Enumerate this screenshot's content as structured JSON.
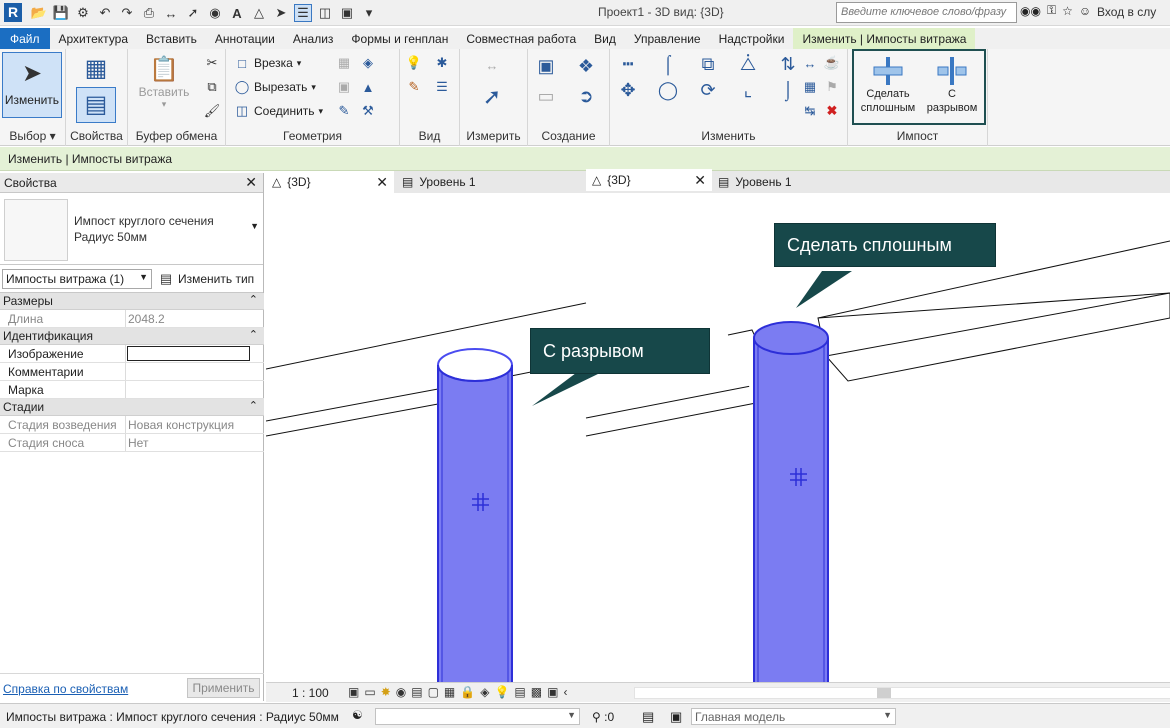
{
  "app": {
    "logo": "R",
    "title": "Проект1 - 3D вид: {3D}",
    "search_placeholder": "Введите ключевое слово/фразу",
    "login": "Вход в слу"
  },
  "tabs": [
    "Файл",
    "Архитектура",
    "Вставить",
    "Аннотации",
    "Анализ",
    "Формы и генплан",
    "Совместная работа",
    "Вид",
    "Управление",
    "Надстройки",
    "Изменить | Импосты витража"
  ],
  "ribbon": {
    "modify_label": "Изменить",
    "paste_label": "Вставить",
    "groups": {
      "select": "Выбор",
      "properties": "Свойства",
      "clipboard": "Буфер обмена",
      "geometry": "Геометрия",
      "view": "Вид",
      "measure": "Измерить",
      "create": "Создание",
      "modify": "Изменить",
      "mullion": "Импост"
    },
    "geometry_buttons": [
      "Врезка",
      "Вырезать",
      "Соединить"
    ],
    "mullion_buttons": {
      "solid": "Сделать сплошным",
      "break": "С разрывом"
    }
  },
  "context_bar": "Изменить | Импосты витража",
  "properties": {
    "title": "Свойства",
    "type_name_line1": "Импост круглого сечения",
    "type_name_line2": "Радиус 50мм",
    "filter": "Импосты витража (1)",
    "edit_type": "Изменить тип",
    "sections": [
      {
        "name": "Размеры",
        "rows": [
          {
            "k": "Длина",
            "v": "2048.2",
            "ro": true
          }
        ]
      },
      {
        "name": "Идентификация",
        "rows": [
          {
            "k": "Изображение",
            "v": "",
            "ro": false,
            "box": true
          },
          {
            "k": "Комментарии",
            "v": "",
            "ro": false
          },
          {
            "k": "Марка",
            "v": "",
            "ro": false
          }
        ]
      },
      {
        "name": "Стадии",
        "rows": [
          {
            "k": "Стадия возведения",
            "v": "Новая конструкция",
            "ro": true
          },
          {
            "k": "Стадия сноса",
            "v": "Нет",
            "ro": true
          }
        ]
      }
    ],
    "help_link": "Справка по свойствам",
    "apply": "Применить"
  },
  "view_tabs": [
    {
      "label": "{3D}",
      "active": true
    },
    {
      "label": "Уровень 1",
      "active": false
    },
    {
      "label": "{3D}",
      "active": true
    },
    {
      "label": "Уровень 1",
      "active": false
    }
  ],
  "callouts": {
    "solid": "Сделать сплошным",
    "break": "С разрывом"
  },
  "view_scale": "1 : 100",
  "status": {
    "text": "Импосты витража : Импост круглого сечения : Радиус 50мм",
    "count": ":0",
    "model": "Главная модель"
  },
  "colors": {
    "mullion_fill": "#7b7cf2",
    "mullion_edge": "#2d2fd8",
    "callout_bg": "#17484a",
    "file_tab": "#1b6ec2",
    "context_tab": "#dff0c8"
  }
}
